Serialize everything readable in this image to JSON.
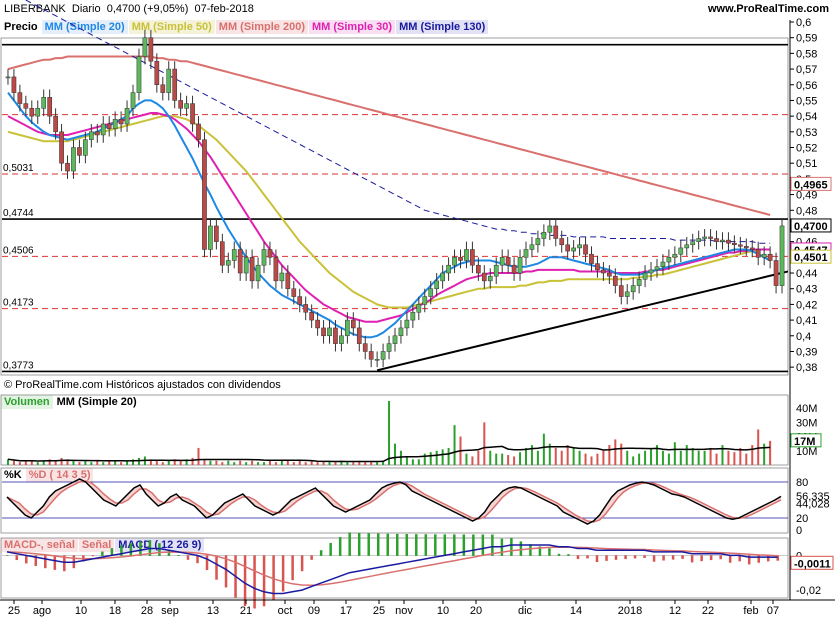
{
  "header": {
    "ticker": "LIBERBANK",
    "period": "Diario",
    "price_change": "0,4700 (+9,05%)",
    "date": "07-feb-2018",
    "site": "www.ProRealTime.com"
  },
  "price_panel": {
    "legend": [
      {
        "label": "Precio",
        "color": "#000000",
        "bg": "#ffffff"
      },
      {
        "label": "MM (Simple 20)",
        "color": "#1e88e5",
        "bg": "#e6eefa"
      },
      {
        "label": "MM (Simple 50)",
        "color": "#c9c238",
        "bg": "#f4f2d8"
      },
      {
        "label": "MM (Simple 200)",
        "color": "#d9706e",
        "bg": "#f8e4e4"
      },
      {
        "label": "MM (Simple 30)",
        "color": "#e020b0",
        "bg": "#f8e0f2"
      },
      {
        "label": "MM (Simple 130)",
        "color": "#1a1aa0",
        "bg": "#e2e2f4"
      }
    ],
    "copyright": "© ProRealTime.com Históricos ajustados con dividendos",
    "y_ticks": [
      "0,6",
      "0,59",
      "0,58",
      "0,57",
      "0,56",
      "0,55",
      "0,54",
      "0,53",
      "0,52",
      "0,51",
      "0,5",
      "0,49",
      "0,48",
      "0,47",
      "0,46",
      "0,45",
      "0,44",
      "0,43",
      "0,42",
      "0,41",
      "0,4",
      "0,39",
      "0,38"
    ],
    "level_labels": [
      "0,5031",
      "0,4744",
      "0,4506",
      "0,4173",
      "0,3773"
    ],
    "value_tags": [
      {
        "text": "0,4965",
        "color": "#d9706e"
      },
      {
        "text": "0,4700",
        "color": "#000000"
      },
      {
        "text": "0,4547",
        "color": "#e020b0"
      },
      {
        "text": "0,4501",
        "color": "#c9c238"
      }
    ]
  },
  "volume_panel": {
    "legend": [
      {
        "label": "Volumen",
        "color": "#2ca02c",
        "bg": "#e4f4e4"
      },
      {
        "label": "MM (Simple 20)",
        "color": "#000000",
        "bg": "#ffffff"
      }
    ],
    "y_ticks": [
      "40M",
      "30M",
      "20M",
      "10M"
    ],
    "value_tag": "17M"
  },
  "stoch_panel": {
    "legend": [
      {
        "label": "%K",
        "color": "#000000",
        "bg": "#ffffff"
      },
      {
        "label": "%D ( 14 3 5)",
        "color": "#d9706e",
        "bg": "#f8e4e4"
      }
    ],
    "y_ticks": [
      "80",
      "56,335",
      "44,028",
      "20",
      "0"
    ]
  },
  "macd_panel": {
    "legend": [
      {
        "label": "MACD-, señal",
        "color": "#d9706e",
        "bg": "#f8e4e4"
      },
      {
        "label": "Señal",
        "color": "#d9706e",
        "bg": "#f8e4e4"
      },
      {
        "label": "MACD ( 12 26 9)",
        "color": "#1a1aa0",
        "bg": "#e2e2f4"
      }
    ],
    "y_ticks": [
      "0",
      "-0,02"
    ],
    "value_tag": "-0,0011"
  },
  "x_axis": {
    "labels": [
      "25",
      "ago",
      "10",
      "18",
      "28",
      "sep",
      "13",
      "21",
      "oct",
      "09",
      "17",
      "25",
      "nov",
      "10",
      "20",
      "dic",
      "14",
      "2018",
      "12",
      "22",
      "feb",
      "07"
    ]
  },
  "chart_data": {
    "type": "candlestick",
    "ylim": [
      0.375,
      0.6
    ],
    "horizontal_levels": [
      0.5031,
      0.4744,
      0.4506,
      0.4173,
      0.3773,
      0.541
    ],
    "closes": [
      0.565,
      0.555,
      0.548,
      0.545,
      0.54,
      0.545,
      0.552,
      0.54,
      0.53,
      0.51,
      0.505,
      0.52,
      0.515,
      0.525,
      0.53,
      0.528,
      0.535,
      0.532,
      0.538,
      0.535,
      0.545,
      0.555,
      0.578,
      0.59,
      0.575,
      0.56,
      0.555,
      0.57,
      0.55,
      0.545,
      0.548,
      0.535,
      0.525,
      0.455,
      0.47,
      0.46,
      0.445,
      0.448,
      0.455,
      0.44,
      0.45,
      0.435,
      0.445,
      0.455,
      0.45,
      0.435,
      0.44,
      0.43,
      0.425,
      0.42,
      0.415,
      0.41,
      0.405,
      0.4,
      0.405,
      0.395,
      0.4,
      0.41,
      0.405,
      0.395,
      0.39,
      0.385,
      0.385,
      0.39,
      0.395,
      0.4,
      0.405,
      0.41,
      0.415,
      0.42,
      0.425,
      0.43,
      0.435,
      0.44,
      0.445,
      0.45,
      0.448,
      0.455,
      0.445,
      0.44,
      0.435,
      0.438,
      0.445,
      0.45,
      0.445,
      0.44,
      0.45,
      0.455,
      0.458,
      0.462,
      0.466,
      0.47,
      0.462,
      0.458,
      0.454,
      0.456,
      0.458,
      0.452,
      0.446,
      0.442,
      0.44,
      0.438,
      0.432,
      0.425,
      0.428,
      0.432,
      0.436,
      0.44,
      0.442,
      0.444,
      0.447,
      0.45,
      0.452,
      0.456,
      0.458,
      0.46,
      0.462,
      0.463,
      0.462,
      0.46,
      0.461,
      0.459,
      0.458,
      0.457,
      0.456,
      0.455,
      0.45,
      0.452,
      0.448,
      0.432,
      0.47
    ],
    "sma20": [
      0.555,
      0.55,
      0.545,
      0.54,
      0.536,
      0.533,
      0.53,
      0.528,
      0.527,
      0.526,
      0.525,
      0.526,
      0.527,
      0.528,
      0.529,
      0.53,
      0.532,
      0.534,
      0.536,
      0.538,
      0.54,
      0.545,
      0.548,
      0.55,
      0.55,
      0.548,
      0.545,
      0.54,
      0.534,
      0.527,
      0.52,
      0.513,
      0.505,
      0.497,
      0.49,
      0.482,
      0.475,
      0.468,
      0.462,
      0.456,
      0.45,
      0.445,
      0.44,
      0.436,
      0.432,
      0.429,
      0.426,
      0.424,
      0.422,
      0.42,
      0.418,
      0.416,
      0.414,
      0.412,
      0.41,
      0.407,
      0.405,
      0.403,
      0.401,
      0.4,
      0.399,
      0.399,
      0.4,
      0.402,
      0.405,
      0.408,
      0.412,
      0.416,
      0.42,
      0.424,
      0.428,
      0.432,
      0.436,
      0.44,
      0.442,
      0.444,
      0.446,
      0.447,
      0.448,
      0.448,
      0.448,
      0.448,
      0.447,
      0.446,
      0.445,
      0.444,
      0.444,
      0.444,
      0.445,
      0.446,
      0.448,
      0.45,
      0.45,
      0.45,
      0.449,
      0.448,
      0.447,
      0.446,
      0.445,
      0.444,
      0.443,
      0.442,
      0.44,
      0.439,
      0.439,
      0.439,
      0.439,
      0.44,
      0.441,
      0.442,
      0.443,
      0.444,
      0.445,
      0.446,
      0.447,
      0.448,
      0.449,
      0.45,
      0.451,
      0.452,
      0.453,
      0.454,
      0.455,
      0.455,
      0.455,
      0.454,
      0.452,
      0.45,
      0.448
    ],
    "sma30": [
      0.54,
      0.538,
      0.536,
      0.534,
      0.532,
      0.53,
      0.529,
      0.528,
      0.528,
      0.528,
      0.528,
      0.529,
      0.53,
      0.531,
      0.532,
      0.533,
      0.534,
      0.535,
      0.536,
      0.537,
      0.538,
      0.539,
      0.54,
      0.541,
      0.542,
      0.542,
      0.541,
      0.54,
      0.538,
      0.535,
      0.532,
      0.528,
      0.524,
      0.519,
      0.514,
      0.508,
      0.502,
      0.496,
      0.49,
      0.484,
      0.478,
      0.472,
      0.466,
      0.46,
      0.455,
      0.45,
      0.445,
      0.441,
      0.437,
      0.433,
      0.429,
      0.426,
      0.423,
      0.42,
      0.418,
      0.416,
      0.414,
      0.412,
      0.411,
      0.41,
      0.409,
      0.409,
      0.409,
      0.41,
      0.411,
      0.412,
      0.413,
      0.415,
      0.417,
      0.419,
      0.421,
      0.423,
      0.426,
      0.428,
      0.43,
      0.432,
      0.434,
      0.436,
      0.437,
      0.438,
      0.439,
      0.44,
      0.44,
      0.44,
      0.44,
      0.44,
      0.44,
      0.441,
      0.441,
      0.442,
      0.442,
      0.442,
      0.442,
      0.442,
      0.442,
      0.442,
      0.441,
      0.441,
      0.441,
      0.441,
      0.441,
      0.441,
      0.44,
      0.44,
      0.44,
      0.44,
      0.44,
      0.441,
      0.441,
      0.442,
      0.442,
      0.443,
      0.444,
      0.445,
      0.446,
      0.447,
      0.448,
      0.449,
      0.45,
      0.451,
      0.452,
      0.453,
      0.453,
      0.454,
      0.454,
      0.455,
      0.455,
      0.455,
      0.455
    ],
    "sma50": [
      0.53,
      0.529,
      0.528,
      0.527,
      0.526,
      0.525,
      0.524,
      0.524,
      0.524,
      0.524,
      0.524,
      0.525,
      0.526,
      0.527,
      0.528,
      0.529,
      0.53,
      0.531,
      0.532,
      0.533,
      0.534,
      0.535,
      0.536,
      0.537,
      0.538,
      0.539,
      0.54,
      0.54,
      0.54,
      0.539,
      0.538,
      0.536,
      0.534,
      0.531,
      0.528,
      0.525,
      0.521,
      0.517,
      0.513,
      0.509,
      0.505,
      0.5,
      0.495,
      0.49,
      0.485,
      0.48,
      0.475,
      0.47,
      0.465,
      0.46,
      0.456,
      0.452,
      0.448,
      0.444,
      0.44,
      0.437,
      0.434,
      0.431,
      0.428,
      0.426,
      0.424,
      0.422,
      0.42,
      0.419,
      0.418,
      0.418,
      0.418,
      0.418,
      0.419,
      0.42,
      0.421,
      0.422,
      0.423,
      0.424,
      0.425,
      0.426,
      0.427,
      0.428,
      0.429,
      0.43,
      0.43,
      0.431,
      0.431,
      0.431,
      0.431,
      0.431,
      0.432,
      0.432,
      0.433,
      0.434,
      0.434,
      0.435,
      0.435,
      0.435,
      0.436,
      0.436,
      0.436,
      0.436,
      0.436,
      0.436,
      0.436,
      0.436,
      0.436,
      0.436,
      0.436,
      0.437,
      0.437,
      0.438,
      0.438,
      0.439,
      0.439,
      0.44,
      0.441,
      0.442,
      0.443,
      0.444,
      0.445,
      0.446,
      0.447,
      0.448,
      0.449,
      0.45,
      0.451,
      0.452,
      0.453,
      0.454,
      0.455,
      0.455,
      0.455
    ],
    "sma130": [
      0.62,
      0.618,
      0.616,
      0.614,
      0.612,
      0.61,
      0.608,
      0.606,
      0.604,
      0.602,
      0.6,
      0.598,
      0.596,
      0.594,
      0.592,
      0.59,
      0.588,
      0.586,
      0.584,
      0.582,
      0.58,
      0.578,
      0.576,
      0.574,
      0.572,
      0.57,
      0.568,
      0.566,
      0.564,
      0.562,
      0.56,
      0.558,
      0.556,
      0.554,
      0.552,
      0.55,
      0.548,
      0.546,
      0.544,
      0.542,
      0.54,
      0.538,
      0.536,
      0.534,
      0.532,
      0.53,
      0.528,
      0.526,
      0.524,
      0.522,
      0.52,
      0.518,
      0.516,
      0.514,
      0.512,
      0.51,
      0.508,
      0.506,
      0.504,
      0.502,
      0.5,
      0.498,
      0.496,
      0.494,
      0.492,
      0.49,
      0.488,
      0.486,
      0.484,
      0.482,
      0.48,
      0.479,
      0.478,
      0.477,
      0.476,
      0.475,
      0.474,
      0.473,
      0.472,
      0.471,
      0.47,
      0.469,
      0.468,
      0.468,
      0.467,
      0.467,
      0.466,
      0.466,
      0.465,
      0.465,
      0.465,
      0.464,
      0.464,
      0.464,
      0.464,
      0.463,
      0.463,
      0.463,
      0.463,
      0.463,
      0.463,
      0.462,
      0.462,
      0.462,
      0.462,
      0.462,
      0.462,
      0.462,
      0.462,
      0.462,
      0.462,
      0.462,
      0.461,
      0.461,
      0.461,
      0.461,
      0.461,
      0.461,
      0.461,
      0.46,
      0.46,
      0.46,
      0.46,
      0.46,
      0.46,
      0.46,
      0.459,
      0.459,
      0.459
    ],
    "sma200": [
      0.57,
      0.571,
      0.572,
      0.573,
      0.574,
      0.575,
      0.576,
      0.576,
      0.577,
      0.577,
      0.578,
      0.578,
      0.578,
      0.578,
      0.578,
      0.578,
      0.578,
      0.578,
      0.578,
      0.578,
      0.578,
      0.578,
      0.578,
      0.578,
      0.578,
      0.577,
      0.577,
      0.576,
      0.576,
      0.575,
      0.575,
      0.574,
      0.573,
      0.572,
      0.571,
      0.57,
      0.569,
      0.568,
      0.567,
      0.566,
      0.565,
      0.564,
      0.563,
      0.562,
      0.561,
      0.56,
      0.559,
      0.558,
      0.557,
      0.556,
      0.555,
      0.554,
      0.553,
      0.552,
      0.551,
      0.55,
      0.549,
      0.548,
      0.547,
      0.546,
      0.545,
      0.544,
      0.543,
      0.542,
      0.541,
      0.54,
      0.539,
      0.538,
      0.537,
      0.536,
      0.535,
      0.534,
      0.533,
      0.532,
      0.531,
      0.53,
      0.529,
      0.528,
      0.527,
      0.526,
      0.525,
      0.524,
      0.523,
      0.522,
      0.521,
      0.52,
      0.519,
      0.518,
      0.517,
      0.516,
      0.515,
      0.514,
      0.513,
      0.512,
      0.511,
      0.51,
      0.509,
      0.508,
      0.507,
      0.506,
      0.505,
      0.504,
      0.503,
      0.502,
      0.501,
      0.5,
      0.499,
      0.498,
      0.497,
      0.496,
      0.495,
      0.494,
      0.493,
      0.492,
      0.491,
      0.49,
      0.489,
      0.488,
      0.487,
      0.486,
      0.485,
      0.484,
      0.483,
      0.482,
      0.481,
      0.48,
      0.479,
      0.478,
      0.477
    ],
    "volumes": [
      4,
      3,
      2,
      3,
      3,
      2,
      3,
      4,
      3,
      5,
      4,
      3,
      2,
      3,
      2,
      3,
      2,
      3,
      3,
      2,
      3,
      4,
      5,
      6,
      4,
      3,
      2,
      3,
      4,
      3,
      4,
      5,
      12,
      4,
      3,
      3,
      2,
      3,
      2,
      3,
      2,
      3,
      2,
      2,
      3,
      2,
      3,
      3,
      2,
      3,
      2,
      3,
      2,
      2,
      3,
      2,
      3,
      2,
      2,
      3,
      2,
      3,
      2,
      3,
      45,
      15,
      10,
      6,
      4,
      4,
      8,
      9,
      10,
      11,
      12,
      28,
      20,
      8,
      6,
      10,
      30,
      10,
      8,
      8,
      7,
      6,
      9,
      12,
      14,
      10,
      22,
      15,
      12,
      10,
      14,
      12,
      10,
      8,
      6,
      8,
      10,
      14,
      18,
      15,
      10,
      6,
      8,
      10,
      12,
      14,
      10,
      8,
      16,
      10,
      14,
      12,
      10,
      10,
      12,
      8,
      14,
      10,
      9,
      12,
      8,
      14,
      25,
      15,
      17
    ],
    "stoch_k": [
      55,
      45,
      35,
      25,
      20,
      30,
      40,
      55,
      65,
      70,
      75,
      80,
      85,
      80,
      70,
      60,
      50,
      45,
      40,
      50,
      60,
      70,
      75,
      60,
      50,
      40,
      45,
      55,
      60,
      50,
      45,
      40,
      30,
      20,
      25,
      35,
      45,
      50,
      55,
      60,
      50,
      40,
      35,
      30,
      25,
      30,
      40,
      50,
      55,
      60,
      65,
      70,
      60,
      50,
      40,
      35,
      30,
      35,
      40,
      45,
      50,
      60,
      70,
      75,
      78,
      80,
      75,
      65,
      60,
      55,
      50,
      45,
      40,
      35,
      30,
      25,
      20,
      15,
      20,
      30,
      45,
      55,
      65,
      70,
      72,
      70,
      65,
      60,
      55,
      50,
      45,
      40,
      30,
      25,
      20,
      15,
      10,
      15,
      25,
      40,
      55,
      65,
      70,
      75,
      78,
      80,
      78,
      75,
      70,
      65,
      60,
      58,
      55,
      50,
      45,
      40,
      35,
      30,
      25,
      20,
      18,
      20,
      25,
      30,
      35,
      40,
      45,
      50,
      56
    ],
    "macd": [
      0.002,
      0.001,
      0.0,
      -0.001,
      -0.002,
      -0.003,
      -0.004,
      -0.004,
      -0.003,
      -0.002,
      -0.001,
      0.0,
      0.001,
      0.002,
      0.003,
      0.004,
      0.004,
      0.003,
      0.002,
      0.001,
      0.0,
      -0.002,
      -0.005,
      -0.008,
      -0.012,
      -0.016,
      -0.019,
      -0.021,
      -0.022,
      -0.022,
      -0.021,
      -0.02,
      -0.018,
      -0.016,
      -0.014,
      -0.012,
      -0.01,
      -0.009,
      -0.008,
      -0.007,
      -0.006,
      -0.005,
      -0.004,
      -0.003,
      -0.002,
      -0.001,
      0.0,
      0.001,
      0.002,
      0.003,
      0.004,
      0.005,
      0.005,
      0.006,
      0.006,
      0.006,
      0.006,
      0.006,
      0.005,
      0.005,
      0.004,
      0.004,
      0.003,
      0.003,
      0.003,
      0.003,
      0.003,
      0.003,
      0.002,
      0.002,
      0.002,
      0.002,
      0.001,
      0.001,
      0.001,
      0.001,
      0.0,
      0.0,
      -0.001,
      -0.001,
      -0.001,
      -0.0011
    ]
  }
}
